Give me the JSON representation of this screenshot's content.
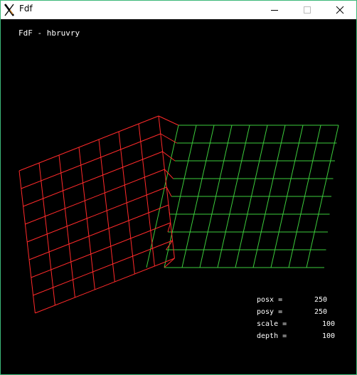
{
  "window": {
    "title": "Fdf"
  },
  "titlebar": {
    "app_icon": "x-app-icon",
    "minimize_icon": "minimize-icon",
    "maximize_icon": "maximize-icon",
    "close_icon": "close-icon"
  },
  "hud": {
    "title": "FdF - hbruvry",
    "stats": [
      {
        "label": "posx =",
        "value": "250"
      },
      {
        "label": "posy =",
        "value": "250"
      },
      {
        "label": "scale =",
        "value": "100"
      },
      {
        "label": "depth =",
        "value": "100"
      }
    ]
  },
  "colors": {
    "background": "#000000",
    "raised_lines": "#ff2a2a",
    "flat_lines": "#3ccc3c",
    "window_border": "#3cb878"
  }
}
